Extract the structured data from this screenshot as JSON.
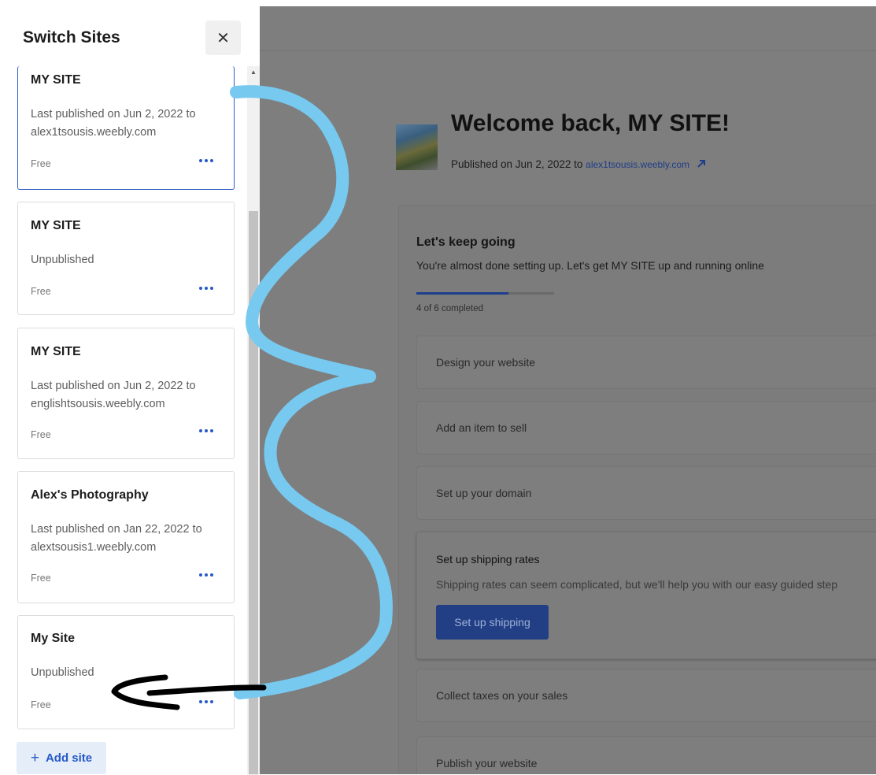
{
  "sidebar": {
    "title": "Switch Sites",
    "close_icon": "close-icon",
    "sites": [
      {
        "name": "MY SITE",
        "status": "Last published on Jun 2, 2022 to alex1tsousis.weebly.com",
        "plan": "Free",
        "selected": true
      },
      {
        "name": "MY SITE",
        "status": "Unpublished",
        "plan": "Free"
      },
      {
        "name": "MY SITE",
        "status": "Last published on Jun 2, 2022 to englishtsousis.weebly.com",
        "plan": "Free"
      },
      {
        "name": "Alex's Photography",
        "status": "Last published on Jan 22, 2022 to alextsousis1.weebly.com",
        "plan": "Free"
      },
      {
        "name": "My Site",
        "status": "Unpublished",
        "plan": "Free"
      }
    ],
    "add_site_label": "Add site"
  },
  "main": {
    "welcome_title": "Welcome back, MY SITE!",
    "published_prefix": "Published on Jun 2, 2022 to",
    "published_url": "alex1tsousis.weebly.com",
    "setup": {
      "title": "Let's keep going",
      "subtitle": "You're almost done setting up. Let's get MY SITE up and running online",
      "progress_text": "4 of 6 completed",
      "progress_fraction": 0.667,
      "steps": [
        {
          "label": "Design your website"
        },
        {
          "label": "Add an item to sell"
        },
        {
          "label": "Set up your domain"
        },
        {
          "label": "Set up shipping rates",
          "description": "Shipping rates can seem complicated, but we'll help you with our easy guided step",
          "button": "Set up shipping"
        },
        {
          "label": "Collect taxes on your sales"
        },
        {
          "label": "Publish your website"
        }
      ]
    }
  },
  "colors": {
    "accent": "#2559c7",
    "annotation_blue": "#77c9f0",
    "annotation_black": "#000000",
    "overlay": "#7e7e7e"
  }
}
